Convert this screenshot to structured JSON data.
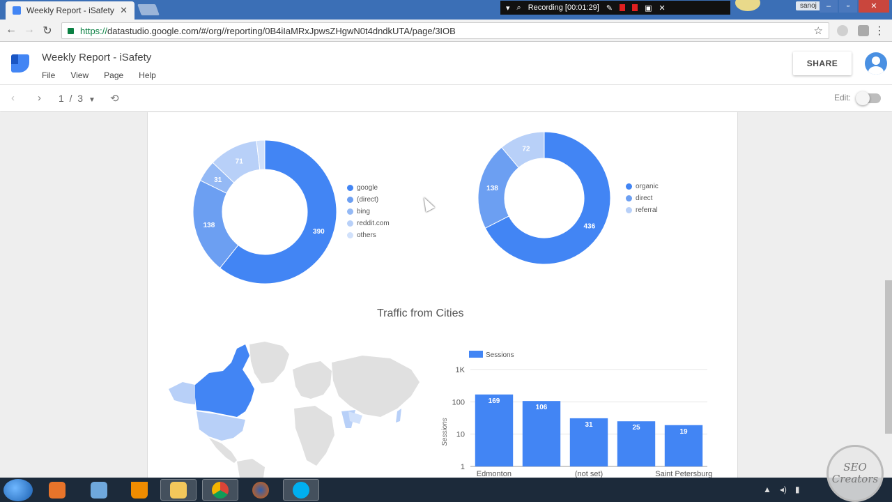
{
  "browser": {
    "tab_title": "Weekly Report - iSafety",
    "tab_close": "✕",
    "url_scheme": "https://",
    "url_rest": "datastudio.google.com/#/org//reporting/0B4iIaMRxJpwsZHgwN0t4dndkUTA/page/3IOB",
    "recording_label": "Recording [00:01:29]",
    "user_chip": "sanoj"
  },
  "app": {
    "report_title": "Weekly Report - iSafety",
    "menu": [
      "File",
      "View",
      "Page",
      "Help"
    ],
    "share_label": "SHARE",
    "page_current": "1",
    "page_sep": "/",
    "page_total": "3",
    "edit_label": "Edit:"
  },
  "colors": {
    "primary": "#4285f4",
    "mid": "#6c9ff2",
    "light": "#94b9f5",
    "lighter": "#b8d0f8",
    "lightest": "#d1e1fb"
  },
  "section_title": "Traffic from Cities",
  "chart_data": [
    {
      "type": "pie",
      "style": "donut",
      "labels": [
        "google",
        "(direct)",
        "bing",
        "reddit.com",
        "others"
      ],
      "values": [
        390,
        138,
        31,
        71,
        12
      ],
      "value_labels": [
        "390",
        "138",
        "31",
        "71",
        ""
      ],
      "legend_position": "right"
    },
    {
      "type": "pie",
      "style": "donut",
      "labels": [
        "organic",
        "direct",
        "referral"
      ],
      "values": [
        436,
        138,
        72
      ],
      "value_labels": [
        "436",
        "138",
        "72"
      ],
      "legend_position": "right"
    },
    {
      "type": "bar",
      "categories": [
        "Edmonton",
        "",
        "(not set)",
        "",
        "Saint Petersburg"
      ],
      "series": [
        {
          "name": "Sessions",
          "values": [
            169,
            106,
            31,
            25,
            19
          ]
        }
      ],
      "ylabel": "Sessions",
      "yscale": "log",
      "yticks": [
        "1",
        "10",
        "100",
        "1K"
      ],
      "ylim": [
        1,
        1000
      ],
      "legend_position": "top-left"
    }
  ],
  "taskbar": {
    "apps": [
      "media-player",
      "paint",
      "vlc",
      "file-explorer",
      "chrome",
      "firefox",
      "skype"
    ],
    "watermark_line1": "SEO",
    "watermark_line2": "Creators"
  }
}
